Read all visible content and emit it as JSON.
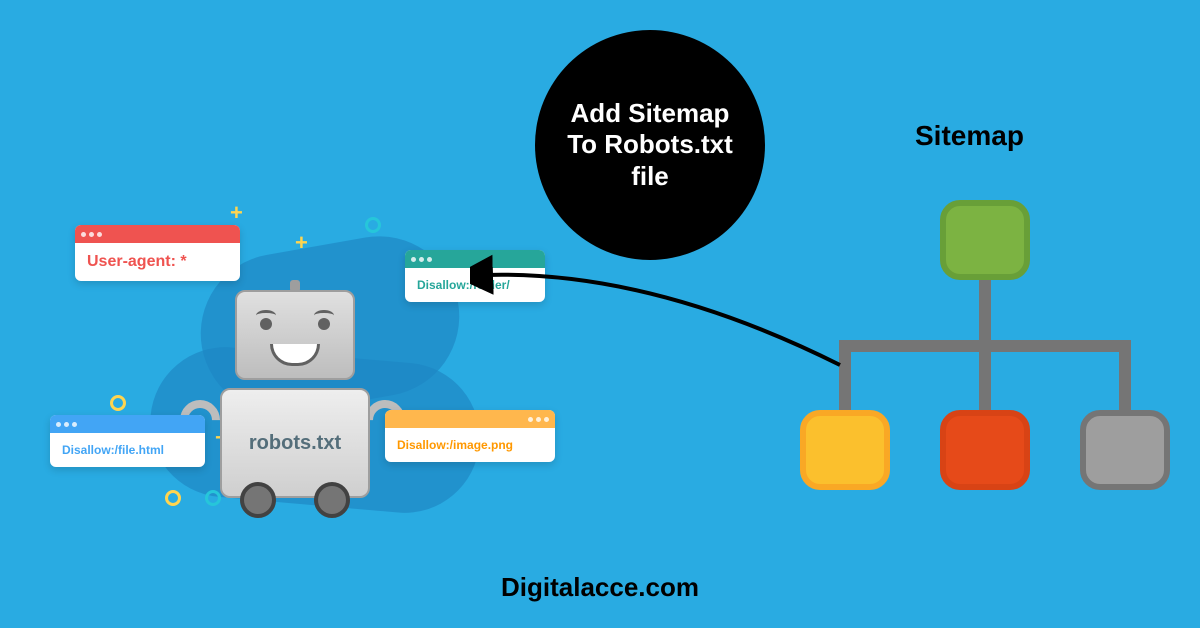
{
  "callout": {
    "text": "Add Sitemap To Robots.txt file"
  },
  "sitemap": {
    "label": "Sitemap",
    "nodes": {
      "root": "green",
      "children": [
        "yellow",
        "orange",
        "gray"
      ]
    }
  },
  "footer": {
    "credit": "Digitalacce.com"
  },
  "robot": {
    "body_label": "robots.txt",
    "popups": {
      "red": "User-agent: *",
      "green": "Disallow:/folder/",
      "blue": "Disallow:/file.html",
      "orange": "Disallow:/image.png"
    }
  },
  "colors": {
    "background": "#29abe2",
    "callout_bg": "#000000",
    "node_green": "#7cb342",
    "node_yellow": "#fbc02d",
    "node_orange": "#e64a19",
    "node_gray": "#9e9e9e"
  }
}
